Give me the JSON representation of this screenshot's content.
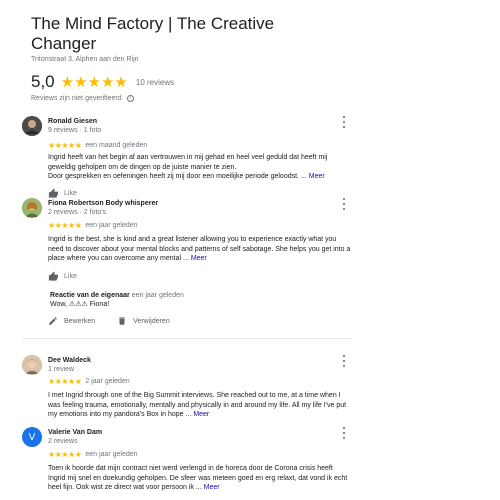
{
  "business": {
    "title_line1": "The Mind Factory | The Creative",
    "title_line2": "Changer",
    "address": "Tritonstraat 3, Alphen aan den Rijn",
    "rating": "5,0",
    "stars": "★★★★★",
    "review_count": "10 reviews",
    "unverified": "Reviews zijn niet geverifieerd",
    "info_glyph": "i"
  },
  "reviews": [
    {
      "name": "Ronald Giesen",
      "meta": "9 reviews · 1 foto",
      "stars": "★★★★★",
      "time": "een maand geleden",
      "text": "Ingrid heeft van het begin af aan vertrouwen in mij gehad en heel veel geduld dat heeft mij geweldig geholpen om de dingen op de juiste manier te zien.",
      "text2": "Door gesprekken en oefeningen heeft zij mij door een moeilijke periode geloodst. ...",
      "more": "Meer",
      "like": "Like",
      "avatar_color": "#3c3c3c"
    },
    {
      "name": "Fiona Robertson Body whisperer",
      "meta": "2 reviews · 2 foto's",
      "stars": "★★★★★",
      "time": "een jaar geleden",
      "text": "Ingrid is the best, she is kind and a great listener allowing you to experience exactly what you need to discover about your mental blocks and patterns of self sabotage. She helps you get into a place where you can overcome any mental ...",
      "more": "Meer",
      "like": "Like",
      "avatar_color": "#8aa35a"
    },
    {
      "name": "Dee Waldeck",
      "meta": "1 review",
      "stars": "★★★★★",
      "time": "2 jaar geleden",
      "text": "I met Ingrid through one of the Big Summit interviews. She reached out to me, at a time when I was feeling trauma, emotionally, mentally and physically in and around my life. All my life I've put my emotions into my pandora's Box in hope ...",
      "more": "Meer",
      "avatar_color": "#c9a27e"
    },
    {
      "name": "Valerie Van Dam",
      "meta": "2 reviews",
      "stars": "★★★★★",
      "time": "een jaar geleden",
      "text": "Toen ik hoorde dat mijn contract niet werd verlengd in de horeca door de Corona crisis heeft Ingrid mij snel en doekundig geholpen. De sfeer was meteen goed en erg relaxt, dat vond ik echt heel fijn. Ook wist ze direct wat voor persoon ik ...",
      "more": "Meer",
      "avatar_letter": "V",
      "avatar_color": "#1a73e8"
    }
  ],
  "owner_reply": {
    "title": "Reactie van de eigenaar",
    "time": "een jaar geleden",
    "text": "Wow, ⚠⚠⚠ Fiona!",
    "edit": "Bewerken",
    "delete": "Verwijderen"
  }
}
